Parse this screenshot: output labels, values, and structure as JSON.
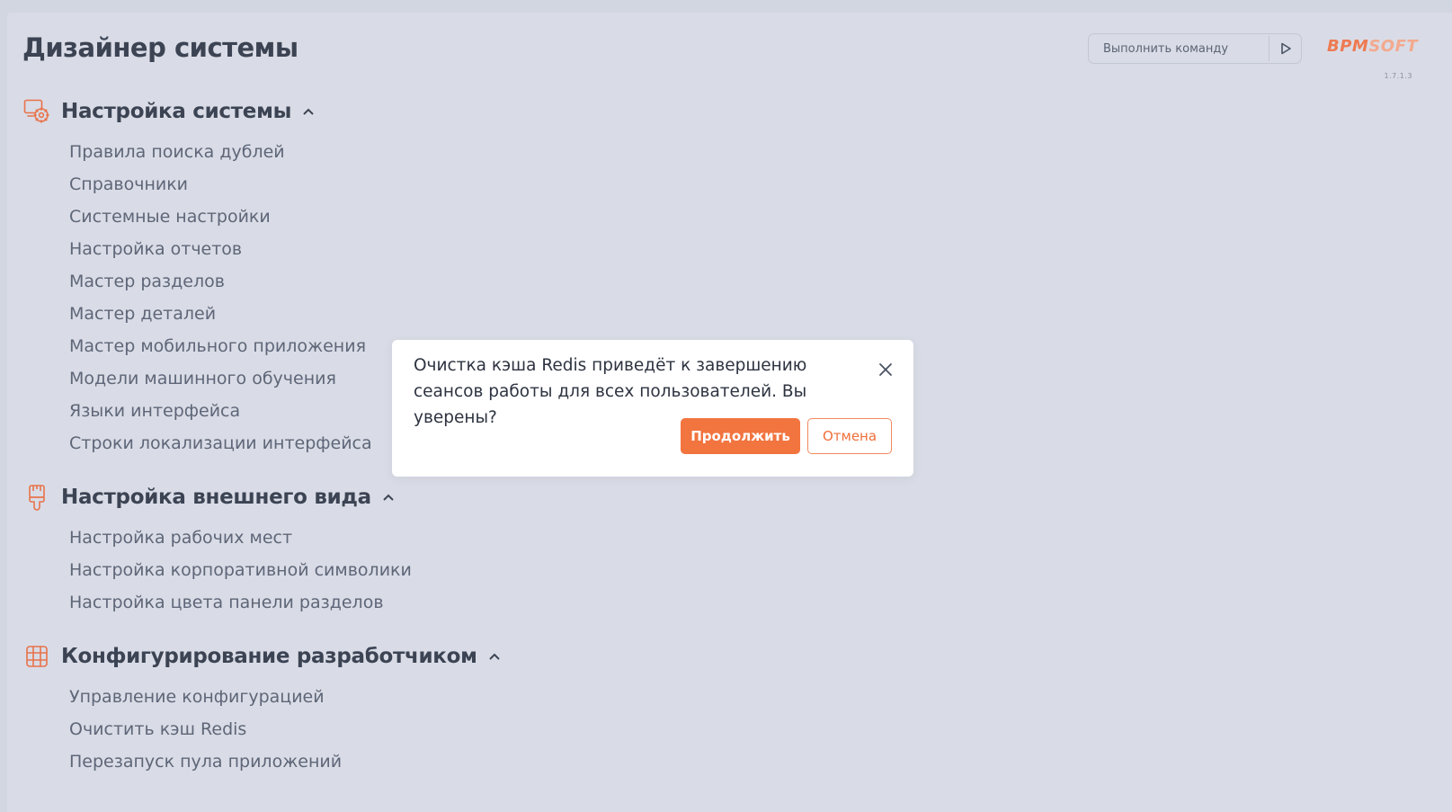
{
  "header": {
    "title": "Дизайнер системы",
    "command_placeholder": "Выполнить команду",
    "logo_primary": "BPM",
    "logo_secondary": "SOFT",
    "version": "1.7.1.3"
  },
  "sections": [
    {
      "title": "Настройка системы",
      "icon": "settings-gear-icon",
      "items": [
        "Правила поиска дублей",
        "Справочники",
        "Системные настройки",
        "Настройка отчетов",
        "Мастер разделов",
        "Мастер деталей",
        "Мастер мобильного приложения",
        "Модели машинного обучения",
        "Языки интерфейса",
        "Строки локализации интерфейса"
      ]
    },
    {
      "title": "Настройка внешнего вида",
      "icon": "brush-icon",
      "items": [
        "Настройка рабочих мест",
        "Настройка корпоративной символики",
        "Настройка цвета панели разделов"
      ]
    },
    {
      "title": "Конфигурирование разработчиком",
      "icon": "grid-icon",
      "items": [
        "Управление конфигурацией",
        "Очистить кэш Redis",
        "Перезапуск пула приложений"
      ]
    }
  ],
  "dialog": {
    "message": "Очистка кэша Redis приведёт к завершению сеансов работы для всех пользователей. Вы уверены?",
    "confirm_label": "Продолжить",
    "cancel_label": "Отмена"
  },
  "colors": {
    "accent": "#f2743f",
    "text_dark": "#3c4454",
    "text_item": "#5e6678",
    "background": "#d9dce6"
  }
}
